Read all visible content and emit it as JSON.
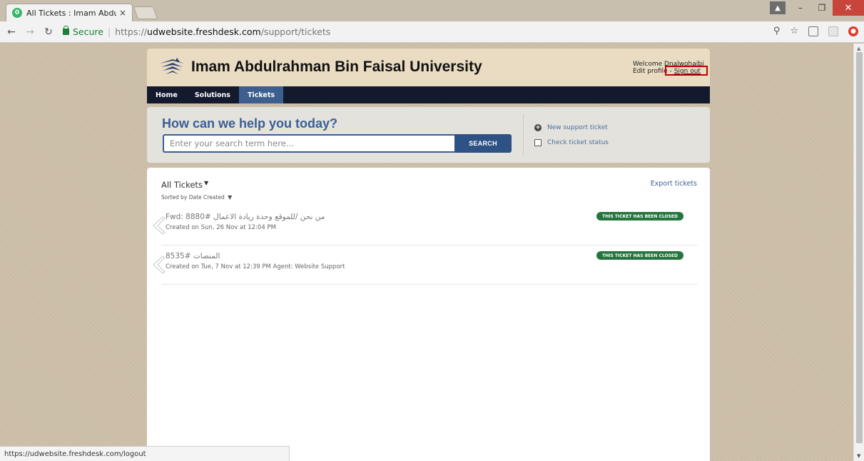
{
  "browser": {
    "tab_title": "All Tickets : Imam Abdulr",
    "tab_close": "×",
    "favicon_letter": "0",
    "url_secure_label": "Secure",
    "url_scheme": "https://",
    "url_host": "udwebsite.freshdesk.com",
    "url_path": "/support/tickets",
    "status_url": "https://udwebsite.freshdesk.com/logout"
  },
  "header": {
    "university_name": "Imam Abdulrahman Bin Faisal University",
    "welcome_text": "Welcome Dnalwohaibi",
    "edit_profile": "Edit profile",
    "separator": " - ",
    "sign_out": "Sign out"
  },
  "nav": {
    "items": [
      {
        "label": "Home"
      },
      {
        "label": "Solutions"
      },
      {
        "label": "Tickets"
      }
    ],
    "active": "Tickets"
  },
  "search": {
    "heading": "How can we help you today?",
    "placeholder": "Enter your search term here...",
    "button_label": "SEARCH",
    "new_ticket": "New support ticket",
    "check_status": "Check ticket status"
  },
  "tickets": {
    "heading": "All Tickets",
    "sorted_label": "Sorted by Date Created",
    "export_label": "Export tickets",
    "rows": [
      {
        "title": "Fwd: من نحن /للموقع وحدة ريادة الاعمال #8880",
        "meta": "Created on Sun, 26 Nov at 12:04 PM",
        "status": "THIS TICKET HAS BEEN CLOSED"
      },
      {
        "title": "المنصات #8535",
        "meta": "Created on Tue, 7 Nov at 12:39 PM Agent: Website Support",
        "status": "THIS TICKET HAS BEEN CLOSED"
      }
    ]
  },
  "colors": {
    "header_bg": "#e9dcc2",
    "nav_bg": "#141a2e",
    "nav_active": "#3d5f8f",
    "accent_blue": "#3a5f95",
    "status_green": "#25753e",
    "highlight_red": "#c00000"
  }
}
